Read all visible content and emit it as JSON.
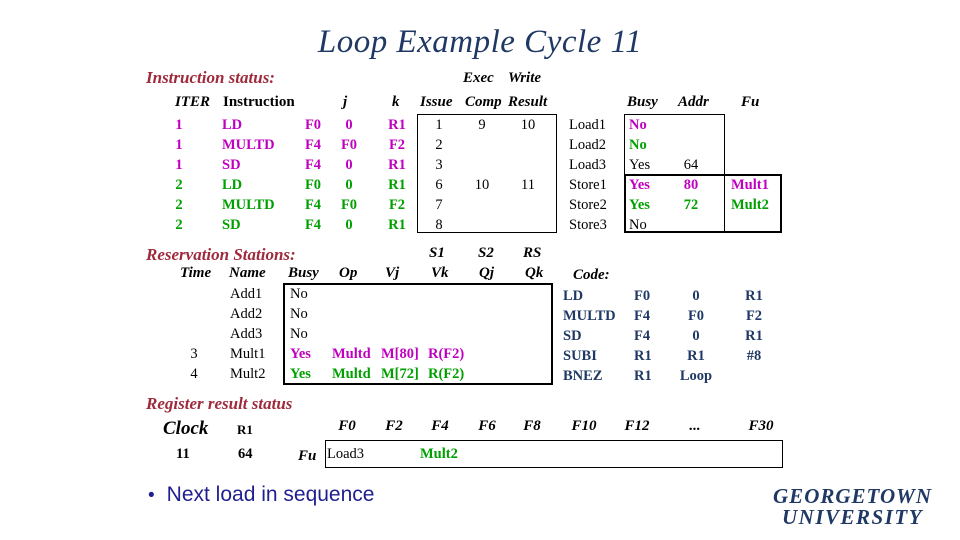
{
  "slide": {
    "title": "Loop Example Cycle 11"
  },
  "instruction_status": {
    "caption": "Instruction status:",
    "exec_label": "Exec",
    "write_label": "Write",
    "headers": {
      "iter": "ITER",
      "instruction": "Instruction",
      "j": "j",
      "k": "k",
      "issue": "Issue",
      "comp": "Comp",
      "result": "Result"
    },
    "rows": [
      {
        "iter": "1",
        "op": "LD",
        "dest": "F0",
        "j": "0",
        "k": "R1",
        "issue": "1",
        "comp": "9",
        "result": "10",
        "color": "magenta"
      },
      {
        "iter": "1",
        "op": "MULTD",
        "dest": "F4",
        "j": "F0",
        "k": "F2",
        "issue": "2",
        "comp": "",
        "result": "",
        "color": "magenta"
      },
      {
        "iter": "1",
        "op": "SD",
        "dest": "F4",
        "j": "0",
        "k": "R1",
        "issue": "3",
        "comp": "",
        "result": "",
        "color": "magenta"
      },
      {
        "iter": "2",
        "op": "LD",
        "dest": "F0",
        "j": "0",
        "k": "R1",
        "issue": "6",
        "comp": "10",
        "result": "11",
        "color": "green"
      },
      {
        "iter": "2",
        "op": "MULTD",
        "dest": "F4",
        "j": "F0",
        "k": "F2",
        "issue": "7",
        "comp": "",
        "result": "",
        "color": "green"
      },
      {
        "iter": "2",
        "op": "SD",
        "dest": "F4",
        "j": "0",
        "k": "R1",
        "issue": "8",
        "comp": "",
        "result": "",
        "color": "green"
      }
    ]
  },
  "load_store": {
    "headers": {
      "busy": "Busy",
      "addr": "Addr",
      "fu": "Fu"
    },
    "rows": [
      {
        "name": "Load1",
        "busy": "No",
        "addr": "",
        "fu": "",
        "color": "magenta"
      },
      {
        "name": "Load2",
        "busy": "No",
        "addr": "",
        "fu": "",
        "color": "green"
      },
      {
        "name": "Load3",
        "busy": "Yes",
        "addr": "64",
        "fu": "",
        "color": "black"
      },
      {
        "name": "Store1",
        "busy": "Yes",
        "addr": "80",
        "fu": "Mult1",
        "color": "magenta"
      },
      {
        "name": "Store2",
        "busy": "Yes",
        "addr": "72",
        "fu": "Mult2",
        "color": "green"
      },
      {
        "name": "Store3",
        "busy": "No",
        "addr": "",
        "fu": "",
        "color": "black"
      }
    ]
  },
  "reservation_stations": {
    "caption": "Reservation Stations:",
    "top_headers": {
      "s1": "S1",
      "s2": "S2",
      "rs": "RS"
    },
    "headers": {
      "time": "Time",
      "name": "Name",
      "busy": "Busy",
      "op": "Op",
      "vj": "Vj",
      "vk": "Vk",
      "qj": "Qj",
      "qk": "Qk"
    },
    "rows": [
      {
        "time": "",
        "name": "Add1",
        "busy": "No",
        "op": "",
        "vj": "",
        "vk": "",
        "qj": "",
        "qk": "",
        "color": "black"
      },
      {
        "time": "",
        "name": "Add2",
        "busy": "No",
        "op": "",
        "vj": "",
        "vk": "",
        "qj": "",
        "qk": "",
        "color": "black"
      },
      {
        "time": "",
        "name": "Add3",
        "busy": "No",
        "op": "",
        "vj": "",
        "vk": "",
        "qj": "",
        "qk": "",
        "color": "black"
      },
      {
        "time": "3",
        "name": "Mult1",
        "busy": "Yes",
        "op": "Multd",
        "vj": "M[80]",
        "vk": "R(F2)",
        "qj": "",
        "qk": "",
        "color": "magenta"
      },
      {
        "time": "4",
        "name": "Mult2",
        "busy": "Yes",
        "op": "Multd",
        "vj": "M[72]",
        "vk": "R(F2)",
        "qj": "",
        "qk": "",
        "color": "green"
      }
    ]
  },
  "code": {
    "caption": "Code:",
    "lines": [
      {
        "op": "LD",
        "a": "F0",
        "b": "0",
        "c": "R1"
      },
      {
        "op": "MULTD",
        "a": "F4",
        "b": "F0",
        "c": "F2"
      },
      {
        "op": "SD",
        "a": "F4",
        "b": "0",
        "c": "R1"
      },
      {
        "op": "SUBI",
        "a": "R1",
        "b": "R1",
        "c": "#8"
      },
      {
        "op": "BNEZ",
        "a": "R1",
        "b": "Loop",
        "c": ""
      }
    ]
  },
  "register_status": {
    "caption": "Register result status",
    "clock_label": "Clock",
    "clock_value": "11",
    "r1_label": "R1",
    "r1_value": "64",
    "fu_label": "Fu",
    "columns": [
      "F0",
      "F2",
      "F4",
      "F6",
      "F8",
      "F10",
      "F12",
      "...",
      "F30"
    ],
    "values": [
      {
        "reg": "F0",
        "fu": "Load3",
        "color": "black"
      },
      {
        "reg": "F2",
        "fu": "",
        "color": "black"
      },
      {
        "reg": "F4",
        "fu": "Mult2",
        "color": "green"
      },
      {
        "reg": "F6",
        "fu": "",
        "color": "black"
      },
      {
        "reg": "F8",
        "fu": "",
        "color": "black"
      },
      {
        "reg": "F10",
        "fu": "",
        "color": "black"
      },
      {
        "reg": "F12",
        "fu": "",
        "color": "black"
      },
      {
        "reg": "...",
        "fu": "",
        "color": "black"
      },
      {
        "reg": "F30",
        "fu": "",
        "color": "black"
      }
    ]
  },
  "bullet": {
    "marker": "•",
    "text": "Next load in sequence"
  },
  "logo": {
    "line1": "GEORGETOWN",
    "line2": "UNIVERSITY"
  },
  "colors": {
    "title": "#1f3864",
    "caption": "#9e2a3c",
    "magenta": "#c000c0",
    "green": "#00a000",
    "black": "#000000",
    "bullet": "#1f1f8f"
  }
}
